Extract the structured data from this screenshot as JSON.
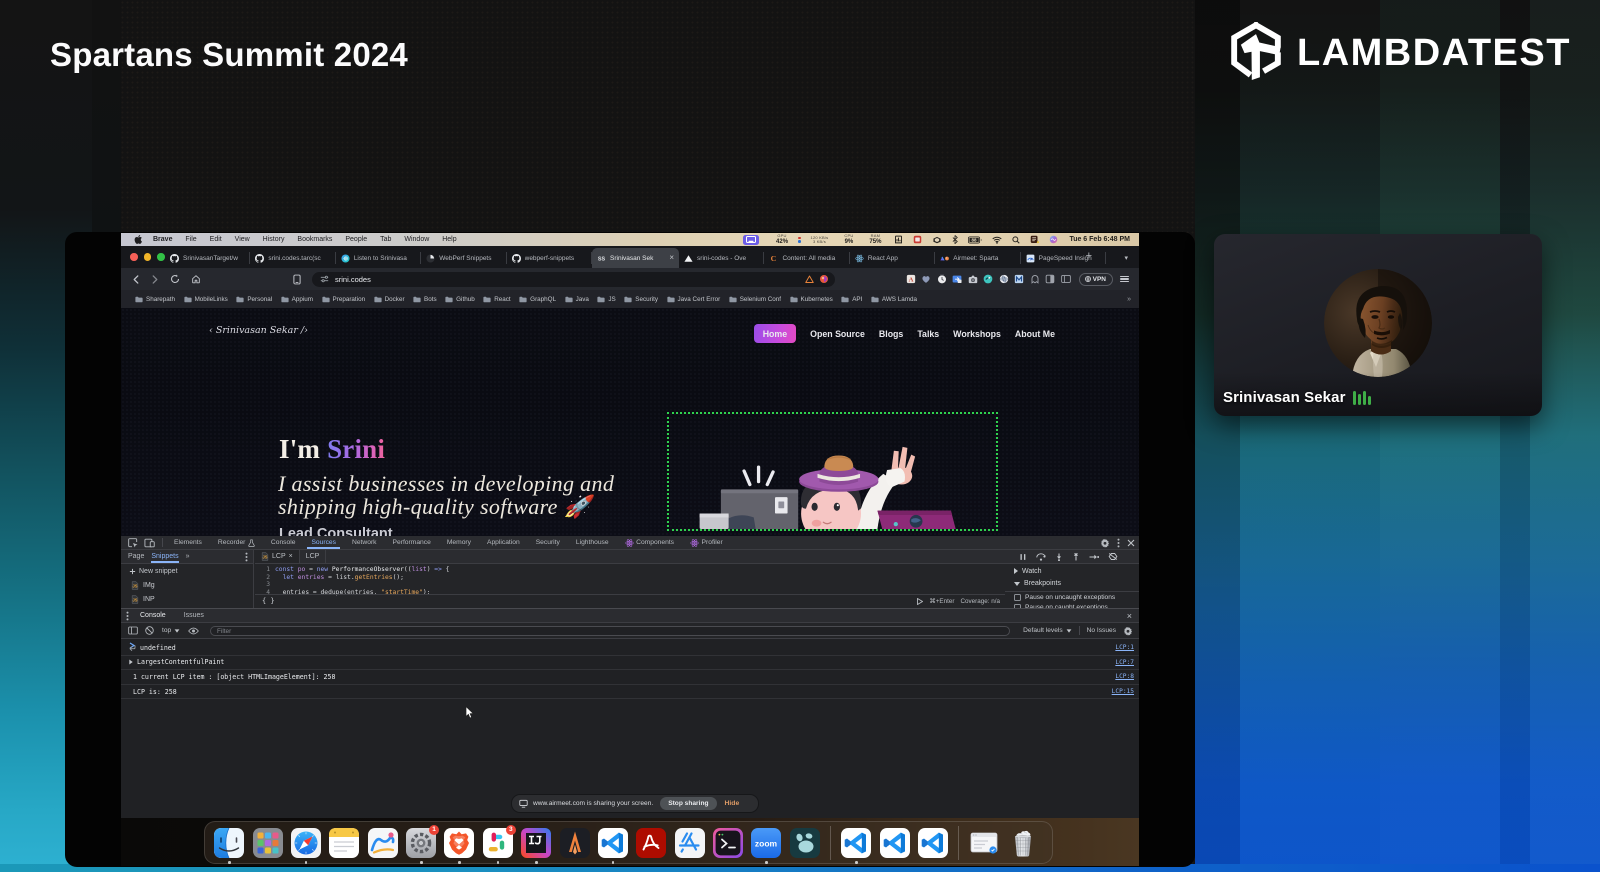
{
  "header": {
    "title": "Spartans Summit 2024",
    "brand": "LAMBDATEST"
  },
  "webcam": {
    "name": "Srinivasan Sekar"
  },
  "menubar": {
    "items": [
      {
        "label": "Brave",
        "bold": true
      },
      {
        "label": "File"
      },
      {
        "label": "Edit"
      },
      {
        "label": "View"
      },
      {
        "label": "History"
      },
      {
        "label": "Bookmarks"
      },
      {
        "label": "People"
      },
      {
        "label": "Tab"
      },
      {
        "label": "Window"
      },
      {
        "label": "Help"
      }
    ],
    "stats": {
      "gpu_label": "GPU",
      "gpu": "42%",
      "net_up": "120 KB/s",
      "net_down": "3 KB/s",
      "cpu_label": "CPU",
      "cpu": "9%",
      "ram_label": "RAM",
      "ram": "75%",
      "battery": "88",
      "clock": "Tue 6 Feb  6:48 PM"
    }
  },
  "browser": {
    "tabs": [
      {
        "icon": "github",
        "label": "SrinivasanTarget/w"
      },
      {
        "icon": "github",
        "label": "srini.codes.tarc(sc"
      },
      {
        "icon": "listen",
        "label": "Listen to Srinivasa"
      },
      {
        "icon": "webperf",
        "label": "WebPerf Snippets"
      },
      {
        "icon": "github",
        "label": "webperf-snippets"
      },
      {
        "icon": "ss",
        "label": "Srinivasan Sek",
        "active": true,
        "close": "×"
      },
      {
        "icon": "vercel",
        "label": "srini-codes - Ove"
      },
      {
        "icon": "contentsquare",
        "label": "Content: All media"
      },
      {
        "icon": "react",
        "label": "React App"
      },
      {
        "icon": "airmeet",
        "label": "Airmeet: Sparta"
      },
      {
        "icon": "pagespeed",
        "label": "PageSpeed Insigh"
      }
    ],
    "url": "srini.codes",
    "vpn_label": "VPN",
    "bookmarks": [
      "Sharepath",
      "MobileLinks",
      "Personal",
      "Appium",
      "Preparation",
      "Docker",
      "Bots",
      "Github",
      "React",
      "GraphQL",
      "Java",
      "JS",
      "Security",
      "Java Cert Error",
      "Selenium Conf",
      "Kubernetes",
      "API",
      "AWS Lamda"
    ]
  },
  "site": {
    "brand": "‹ Srinivasan Sekar /›",
    "nav": [
      {
        "label": "Home",
        "active": true
      },
      {
        "label": "Open Source"
      },
      {
        "label": "Blogs"
      },
      {
        "label": "Talks"
      },
      {
        "label": "Workshops"
      },
      {
        "label": "About Me"
      }
    ],
    "hero_prefix": "I'm ",
    "hero_name": "Srini",
    "tagline1": "I assist businesses in developing and",
    "tagline2": "shipping high-quality software 🚀",
    "role": "Lead Consultant"
  },
  "devtools": {
    "tabs": [
      {
        "label": "Elements"
      },
      {
        "label": "Recorder",
        "suffix": "flask"
      },
      {
        "label": "Console"
      },
      {
        "label": "Sources",
        "active": true
      },
      {
        "label": "Network"
      },
      {
        "label": "Performance"
      },
      {
        "label": "Memory"
      },
      {
        "label": "Application"
      },
      {
        "label": "Security"
      },
      {
        "label": "Lighthouse"
      },
      {
        "label": "Components",
        "icon": "react-dev"
      },
      {
        "label": "Profiler",
        "icon": "react-dev"
      }
    ],
    "sidebar": {
      "tabs": [
        {
          "label": "Page"
        },
        {
          "label": "Snippets",
          "active": true
        }
      ],
      "more": "»",
      "new_snippet": "New snippet",
      "snippets": [
        {
          "icon": "jsfile",
          "label": "IMg"
        },
        {
          "icon": "jsfile",
          "label": "INP"
        }
      ]
    },
    "file_tabs": [
      {
        "label": "LCP",
        "active": true,
        "close": "×",
        "icon": "jsfile"
      },
      {
        "label": "LCP"
      }
    ],
    "code_lines": [
      {
        "n": "1",
        "tokens": [
          {
            "t": "const ",
            "c": "kw"
          },
          {
            "t": "po ",
            "c": "def"
          },
          {
            "t": "= ",
            "c": "op"
          },
          {
            "t": "new ",
            "c": "kw"
          },
          {
            "t": "PerformanceObserver",
            "c": "fn"
          },
          {
            "t": "((",
            "c": "pl"
          },
          {
            "t": "list",
            "c": "def"
          },
          {
            "t": ") ",
            "c": "pl"
          },
          {
            "t": "=> ",
            "c": "kw"
          },
          {
            "t": "{",
            "c": "pl"
          }
        ]
      },
      {
        "n": "2",
        "tokens": [
          {
            "t": "  let ",
            "c": "kw"
          },
          {
            "t": "entries ",
            "c": "def"
          },
          {
            "t": "= ",
            "c": "op"
          },
          {
            "t": "list.",
            "c": "pl"
          },
          {
            "t": "getEntries",
            "c": "prop"
          },
          {
            "t": "();",
            "c": "pl"
          }
        ]
      },
      {
        "n": "3",
        "tokens": []
      },
      {
        "n": "4",
        "tokens": [
          {
            "t": "  entries = dedupe(entries, ",
            "c": "pl"
          },
          {
            "t": "\"startTime\"",
            "c": "str"
          },
          {
            "t": ");",
            "c": "pl"
          }
        ]
      }
    ],
    "status": {
      "pretty": "{ }",
      "run_hint": "⌘+Enter",
      "coverage": "Coverage: n/a"
    },
    "right": {
      "watch": "Watch",
      "breakpoints": "Breakpoints",
      "pause_uncaught": "Pause on uncaught exceptions",
      "pause_caught": "Pause on caught exceptions"
    },
    "console": {
      "tabs": [
        {
          "label": "Console",
          "active": true
        },
        {
          "label": "Issues"
        }
      ],
      "context": "top",
      "filter_placeholder": "Filter",
      "levels": "Default levels",
      "issues": "No Issues",
      "rows": [
        {
          "kind": "result",
          "text": "undefined",
          "link": "LCP:1"
        },
        {
          "kind": "expand",
          "text": "LargestContentfulPaint",
          "link": "LCP:7"
        },
        {
          "kind": "log",
          "text": "1 current LCP item : [object HTMLImageElement]: 258",
          "link": "LCP:8"
        },
        {
          "kind": "log",
          "text": "LCP is: 258",
          "link": "LCP:15"
        }
      ],
      "prompt": "›"
    }
  },
  "sharing": {
    "text": "www.airmeet.com is sharing your screen.",
    "stop": "Stop sharing",
    "hide": "Hide"
  },
  "dock": {
    "apps": [
      {
        "icon": "finder",
        "name": "Finder",
        "running": true
      },
      {
        "icon": "launchpad",
        "name": "Launchpad"
      },
      {
        "icon": "safari",
        "name": "Safari",
        "running": true
      },
      {
        "icon": "notes",
        "name": "Notes"
      },
      {
        "icon": "freeform",
        "name": "Freeform"
      },
      {
        "icon": "settings",
        "name": "System Settings",
        "badge": "1",
        "running": true
      },
      {
        "icon": "brave",
        "name": "Brave",
        "running": true
      },
      {
        "icon": "slack",
        "name": "Slack",
        "badge": "3",
        "running": true
      },
      {
        "icon": "intellij",
        "name": "IntelliJ IDEA",
        "running": true
      },
      {
        "icon": "alacritty",
        "name": "Alacritty"
      },
      {
        "icon": "vscode",
        "name": "Visual Studio Code",
        "running": true
      },
      {
        "icon": "acrobat",
        "name": "Adobe Acrobat"
      },
      {
        "icon": "appstore",
        "name": "App Store"
      },
      {
        "icon": "hyper",
        "name": "Terminal"
      },
      {
        "icon": "zoom",
        "name": "Zoom",
        "running": true
      },
      {
        "icon": "paw",
        "name": "Paw"
      }
    ],
    "windows": [
      {
        "icon": "vscode",
        "name": "VS Code Window",
        "running": true
      },
      {
        "icon": "vscode",
        "name": "VS Code Window"
      },
      {
        "icon": "vscode",
        "name": "VS Code Window"
      }
    ],
    "tail": [
      {
        "icon": "minwindow",
        "name": "Minimized Window"
      },
      {
        "icon": "trash",
        "name": "Trash"
      }
    ]
  }
}
